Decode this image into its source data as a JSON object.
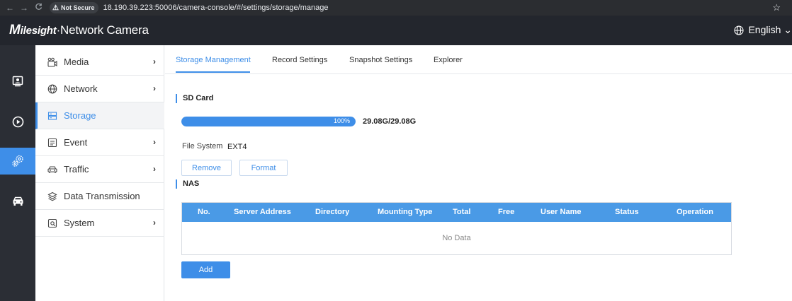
{
  "browser": {
    "back_icon": "←",
    "forward_icon": "→",
    "reload_icon": "C",
    "warn_icon": "⚠",
    "not_secure": "Not Secure",
    "url": "18.190.39.223:50006/camera-console/#/settings/storage/manage",
    "star_icon": "☆"
  },
  "header": {
    "brand_m": "M",
    "brand_rest": "ilesight",
    "product": "·Network Camera",
    "language": "English ⌄"
  },
  "rail": {
    "items": [
      "live-view-icon",
      "playback-icon",
      "settings-icon",
      "vehicle-icon"
    ],
    "active_index": 2,
    "accent": "#3e8ee8"
  },
  "sidebar": {
    "items": [
      {
        "label": "Media",
        "icon": "media-icon",
        "chevron": "›"
      },
      {
        "label": "Network",
        "icon": "globe-icon",
        "chevron": "›"
      },
      {
        "label": "Storage",
        "icon": "storage-icon",
        "chevron": ""
      },
      {
        "label": "Event",
        "icon": "event-icon",
        "chevron": "›"
      },
      {
        "label": "Traffic",
        "icon": "car-icon",
        "chevron": "›"
      },
      {
        "label": "Data Transmission",
        "icon": "layers-icon",
        "chevron": ""
      },
      {
        "label": "System",
        "icon": "system-icon",
        "chevron": "›"
      }
    ],
    "active_index": 2
  },
  "tabs": [
    {
      "label": "Storage Management",
      "active": true
    },
    {
      "label": "Record Settings",
      "active": false
    },
    {
      "label": "Snapshot Settings",
      "active": false
    },
    {
      "label": "Explorer",
      "active": false
    }
  ],
  "sd_card": {
    "title": "SD Card",
    "usage_percent": 100,
    "usage_label": "100%",
    "capacity": "29.08G/29.08G",
    "fs_label": "File System",
    "fs_value": "EXT4",
    "remove_label": "Remove",
    "format_label": "Format"
  },
  "nas": {
    "title": "NAS",
    "columns": [
      "No.",
      "Server Address",
      "Directory",
      "Mounting Type",
      "Total",
      "Free",
      "User Name",
      "Status",
      "Operation"
    ],
    "rows": [],
    "empty_text": "No Data",
    "add_label": "Add"
  }
}
